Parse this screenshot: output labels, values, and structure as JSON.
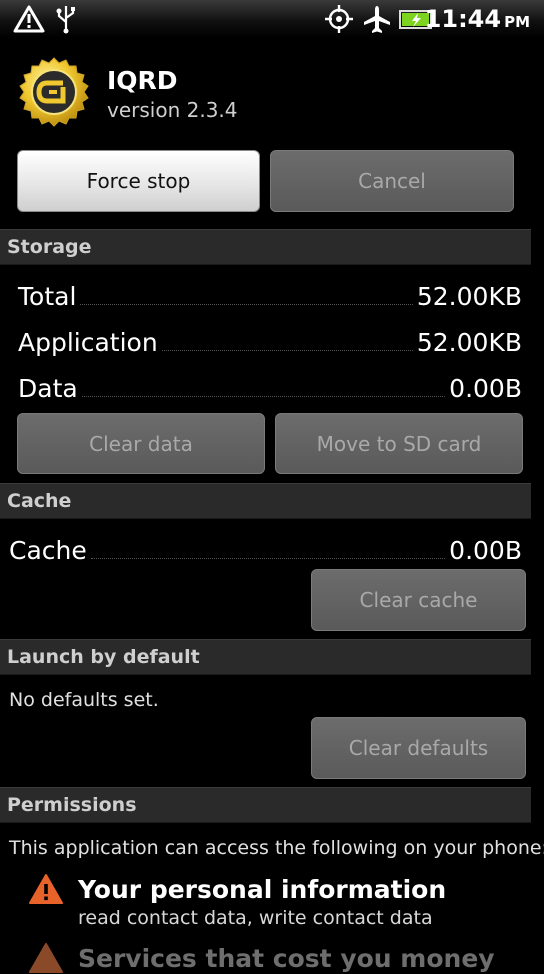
{
  "status_bar": {
    "time": "11:44",
    "ampm": "PM",
    "icons": [
      "warning-icon",
      "usb-icon",
      "gps-icon",
      "airplane-icon",
      "battery-icon"
    ],
    "battery_color": "#7ed321"
  },
  "app": {
    "name": "IQRD",
    "version": "version 2.3.4",
    "icon": "gold-seal-app-icon"
  },
  "buttons": {
    "force_stop": "Force stop",
    "cancel": "Cancel",
    "clear_data": "Clear data",
    "move_to_sd": "Move to SD card",
    "clear_cache": "Clear cache",
    "clear_defaults": "Clear defaults"
  },
  "storage": {
    "header": "Storage",
    "rows": [
      {
        "label": "Total",
        "value": "52.00KB"
      },
      {
        "label": "Application",
        "value": "52.00KB"
      },
      {
        "label": "Data",
        "value": "0.00B"
      }
    ]
  },
  "cache": {
    "header": "Cache",
    "label": "Cache",
    "value": "0.00B"
  },
  "launch": {
    "header": "Launch by default",
    "text": "No defaults set."
  },
  "permissions": {
    "header": "Permissions",
    "intro": "This application can access the following on your phone:",
    "items": [
      {
        "title": "Your personal information",
        "detail": "read contact data, write contact data"
      },
      {
        "title": "Services that cost you money",
        "detail": ""
      }
    ]
  },
  "colors": {
    "warning": "#e8632a",
    "section_bg": "#2a2a2a",
    "seal_gold": "#f0c830"
  }
}
